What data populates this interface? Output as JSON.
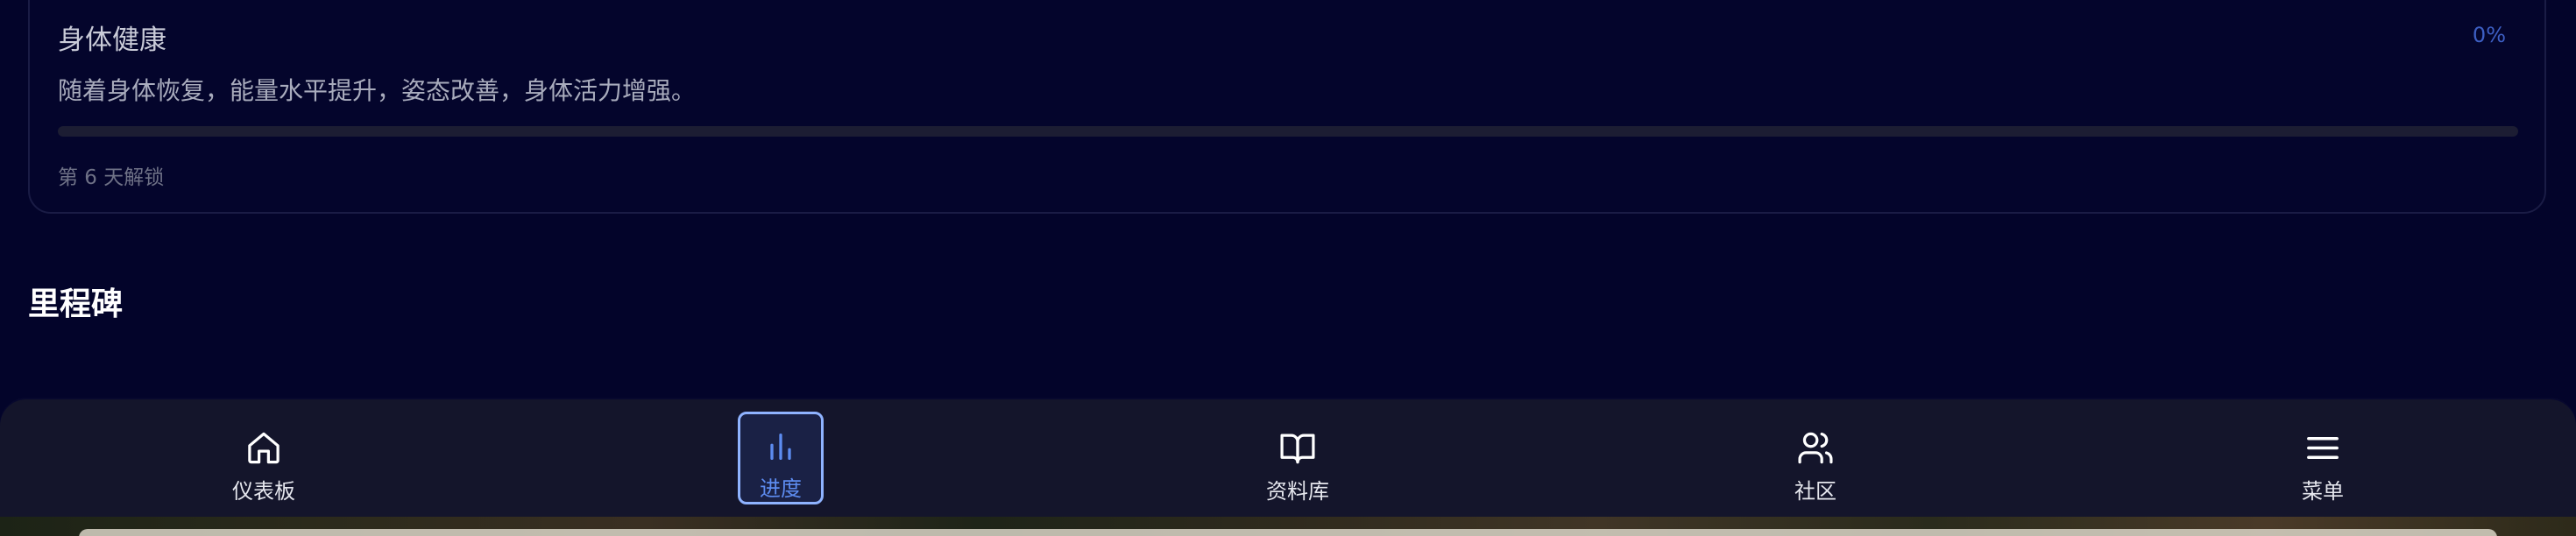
{
  "card": {
    "title": "身体健康",
    "percent_label": "0%",
    "progress": 0,
    "description": "随着身体恢复，能量水平提升，姿态改善，身体活力增强。",
    "unlock_text": "第 6 天解锁"
  },
  "milestones": {
    "title": "里程碑"
  },
  "nav": {
    "items": [
      {
        "label": "仪表板",
        "icon": "home-icon"
      },
      {
        "label": "进度",
        "icon": "bar-chart-icon",
        "active": true
      },
      {
        "label": "资料库",
        "icon": "open-book-icon"
      },
      {
        "label": "社区",
        "icon": "users-icon"
      },
      {
        "label": "菜单",
        "icon": "menu-icon"
      }
    ]
  },
  "colors": {
    "background": "#03042a",
    "card_border": "#1a1c45",
    "accent": "#3d5fc4",
    "active_nav": "#5d8cf0",
    "nav_background": "#14152b"
  }
}
